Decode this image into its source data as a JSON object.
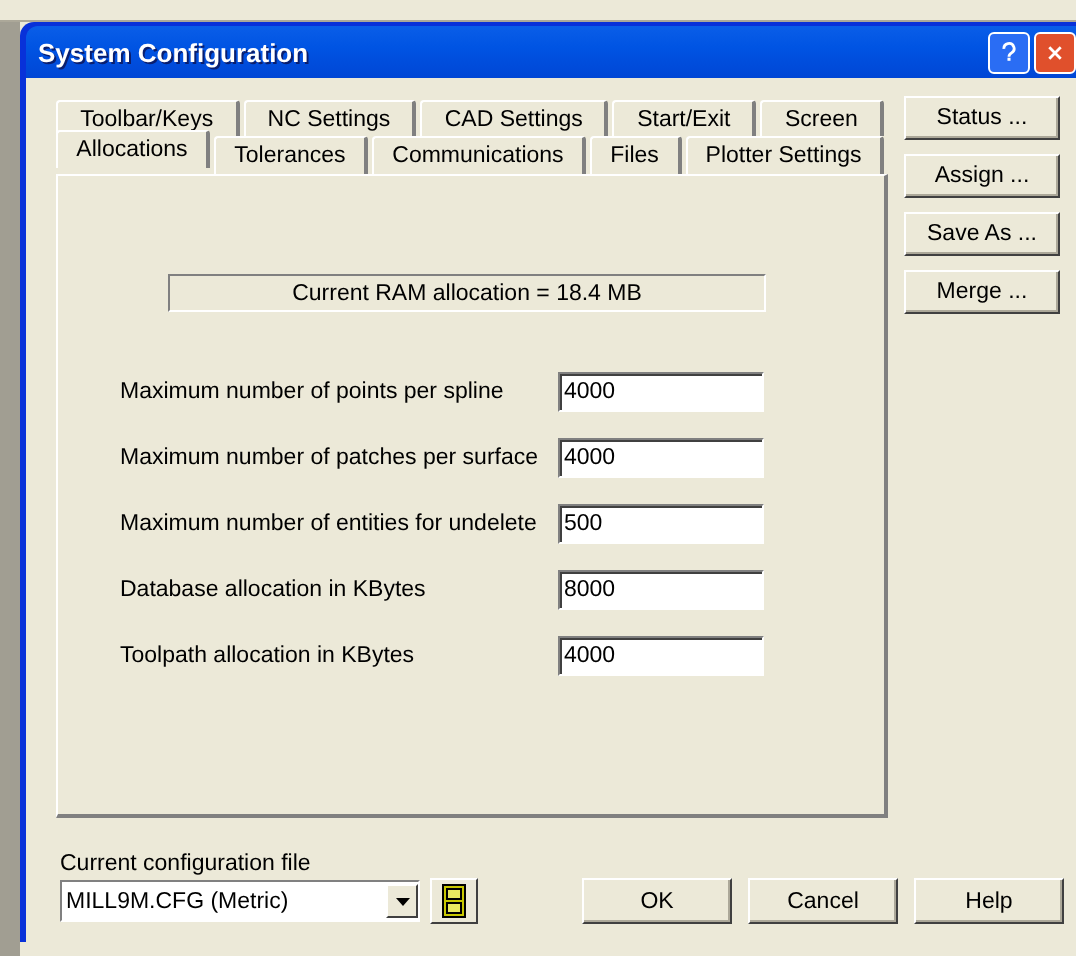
{
  "window": {
    "title": "System Configuration"
  },
  "tab_rows": [
    [
      {
        "label": "Toolbar/Keys",
        "selected": false
      },
      {
        "label": "NC Settings",
        "selected": false
      },
      {
        "label": "CAD Settings",
        "selected": false
      },
      {
        "label": "Start/Exit",
        "selected": false
      },
      {
        "label": "Screen",
        "selected": false
      }
    ],
    [
      {
        "label": "Allocations",
        "selected": true
      },
      {
        "label": "Tolerances",
        "selected": false
      },
      {
        "label": "Communications",
        "selected": false
      },
      {
        "label": "Files",
        "selected": false
      },
      {
        "label": "Plotter Settings",
        "selected": false
      }
    ]
  ],
  "ram_allocation": "Current RAM allocation = 18.4 MB",
  "fields": [
    {
      "label": "Maximum number of points per spline",
      "value": "4000"
    },
    {
      "label": "Maximum number of patches per surface",
      "value": "4000"
    },
    {
      "label": "Maximum number of entities for undelete",
      "value": "500"
    },
    {
      "label": "Database allocation in KBytes",
      "value": "8000"
    },
    {
      "label": "Toolpath allocation in KBytes",
      "value": "4000"
    }
  ],
  "side_buttons": [
    "Status ...",
    "Assign ...",
    "Save As ...",
    "Merge ..."
  ],
  "config_file": {
    "label": "Current configuration file",
    "value": "MILL9M.CFG (Metric)"
  },
  "buttons": [
    "OK",
    "Cancel",
    "Help"
  ]
}
